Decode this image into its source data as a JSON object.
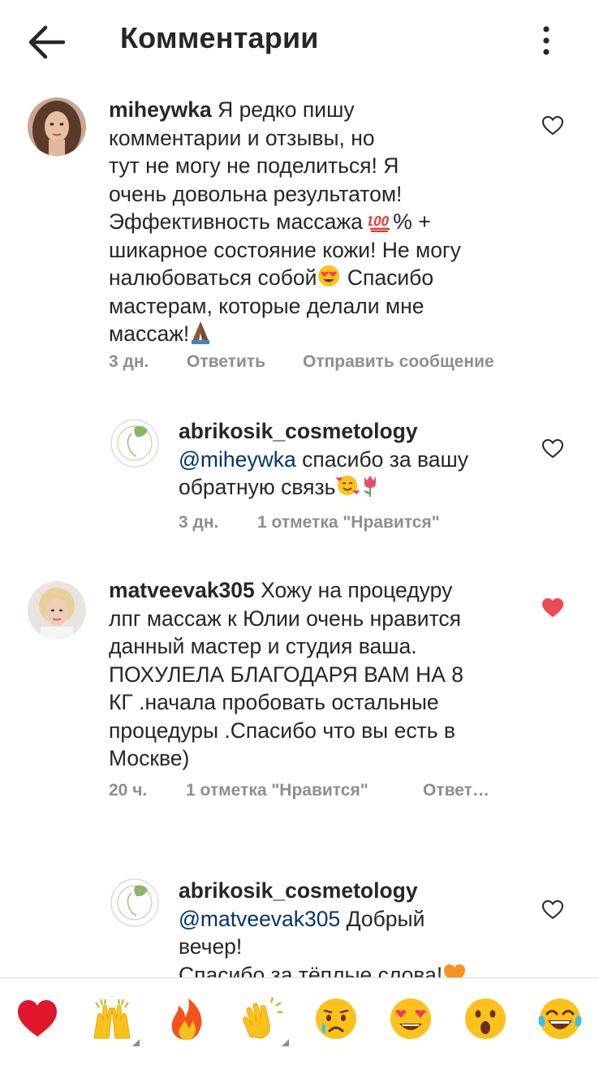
{
  "header": {
    "title": "Комментарии",
    "back_icon": "arrow-left-icon",
    "menu_icon": "more-vertical-icon"
  },
  "comments": [
    {
      "username": "miheywka",
      "text_lines": [
        "Я редко пишу",
        "комментарии и отзывы, но",
        "тут не могу не поделиться! Я",
        "очень довольна результатом!",
        "Эффективность массажа",
        "% +",
        "шикарное состояние кожи! Не могу",
        "налюбоваться собой",
        "Спасибо",
        "мастерам, которые делали мне",
        "массаж!"
      ],
      "time": "3 дн.",
      "reply": "Ответить",
      "send_message": "Отправить сообщение",
      "liked": false
    },
    {
      "username": "abrikosik_cosmetology",
      "mention": "@miheywka",
      "text_lines": [
        "спасибо за вашу",
        "обратную связь"
      ],
      "time": "3 дн.",
      "likes": "1 отметка \"Нравится\"",
      "liked": false
    },
    {
      "username": "matveevak305",
      "text_lines": [
        "Хожу на процедуру",
        "лпг массаж к Юлии очень нравится",
        "данный мастер и студия ваша.",
        "ПОХУЛЕЛА БЛАГОДАРЯ ВАМ НА 8",
        "КГ .начала пробовать остальные",
        "процедуры .Спасибо что вы есть в",
        "Москве)"
      ],
      "time": "20 ч.",
      "likes": "1 отметка \"Нравится\"",
      "reply": "Ответ…",
      "liked": true
    },
    {
      "username": "abrikosik_cosmetology",
      "mention": "@matveevak305",
      "text_lines": [
        "Добрый",
        "вечер!",
        "Спасибо за тёплые слова!"
      ],
      "liked": false
    }
  ],
  "reactions": [
    {
      "icon": "red-heart-icon",
      "has_variants": false
    },
    {
      "icon": "raising-hands-icon",
      "has_variants": true
    },
    {
      "icon": "fire-icon",
      "has_variants": false
    },
    {
      "icon": "clapping-hands-icon",
      "has_variants": true
    },
    {
      "icon": "crying-face-icon",
      "has_variants": false
    },
    {
      "icon": "heart-eyes-face-icon",
      "has_variants": false
    },
    {
      "icon": "surprised-face-icon",
      "has_variants": false
    },
    {
      "icon": "tears-of-joy-face-icon",
      "has_variants": false
    }
  ],
  "colors": {
    "text": "#262626",
    "muted": "#8e8e8e",
    "mention": "#003569",
    "like_red": "#ed4956"
  }
}
